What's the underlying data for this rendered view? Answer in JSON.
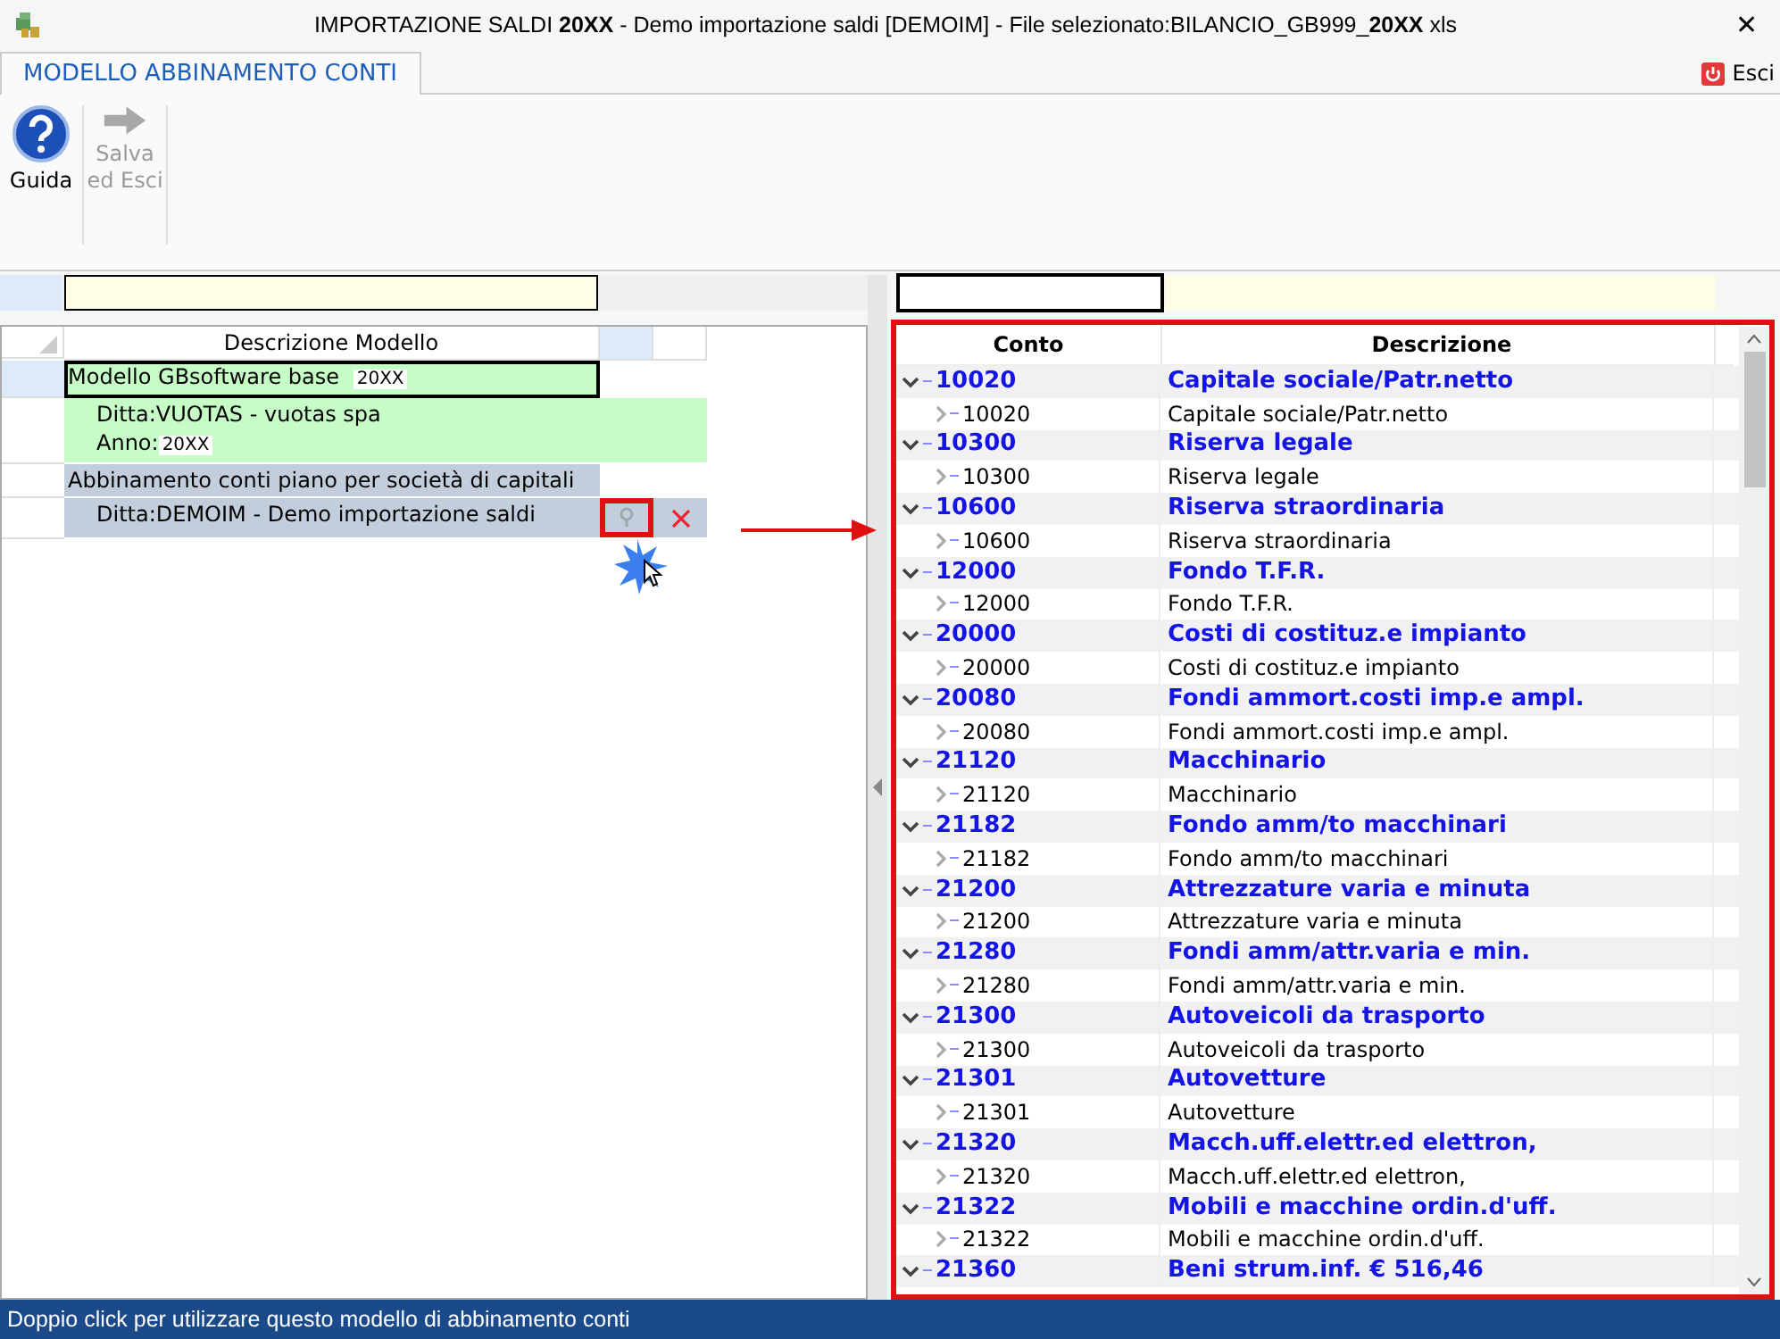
{
  "window": {
    "title": "IMPORTAZIONE SALDI **20XX** - Demo importazione saldi [DEMOIM] - File selezionato:BILANCIO_GB999_**20XX** xls",
    "close": "✕"
  },
  "tabs": [
    {
      "label": "MODELLO ABBINAMENTO CONTI",
      "selected": true
    }
  ],
  "exit_button": "Esci",
  "toolbar": [
    {
      "label": "Guida",
      "disabled": false,
      "kind": "help"
    },
    {
      "label": "Salva\ned Esci",
      "disabled": true,
      "kind": "save"
    }
  ],
  "models": {
    "column": "Descrizione Modello",
    "rows": [
      {
        "kind": "model",
        "label": "Modello GBsoftware base",
        "year": "20XX",
        "color": "#c6fcc6",
        "selected": true
      },
      {
        "kind": "company",
        "label": "Ditta:VUOTAS - vuotas spa",
        "year_label": "Anno:",
        "year": "20XX",
        "color": "#c6fcc6",
        "selected": false
      },
      {
        "kind": "model",
        "label": "Abbinamento conti piano per società di capitali",
        "color": "#c3cedc",
        "selected": false
      },
      {
        "kind": "company",
        "label": "Ditta:DEMOIM - Demo importazione saldi",
        "color": "#c3cedc",
        "selected": false,
        "actions": true
      }
    ]
  },
  "accounts": {
    "columns": [
      "Conto",
      "Descrizione"
    ],
    "rows": [
      {
        "code": "10020",
        "description": "Capitale sociale/Patr.netto",
        "expanded": true,
        "children": [
          {
            "code": "10020",
            "description": "Capitale sociale/Patr.netto"
          }
        ]
      },
      {
        "code": "10300",
        "description": "Riserva legale",
        "expanded": true,
        "children": [
          {
            "code": "10300",
            "description": "Riserva legale"
          }
        ]
      },
      {
        "code": "10600",
        "description": "Riserva straordinaria",
        "expanded": true,
        "children": [
          {
            "code": "10600",
            "description": "Riserva straordinaria"
          }
        ]
      },
      {
        "code": "12000",
        "description": "Fondo T.F.R.",
        "expanded": true,
        "children": [
          {
            "code": "12000",
            "description": "Fondo T.F.R."
          }
        ]
      },
      {
        "code": "20000",
        "description": "Costi di costituz.e impianto",
        "expanded": true,
        "children": [
          {
            "code": "20000",
            "description": "Costi di costituz.e impianto"
          }
        ]
      },
      {
        "code": "20080",
        "description": "Fondi ammort.costi imp.e ampl.",
        "expanded": true,
        "children": [
          {
            "code": "20080",
            "description": "Fondi ammort.costi imp.e ampl."
          }
        ]
      },
      {
        "code": "21120",
        "description": "Macchinario",
        "expanded": true,
        "children": [
          {
            "code": "21120",
            "description": "Macchinario"
          }
        ]
      },
      {
        "code": "21182",
        "description": "Fondo amm/to macchinari",
        "expanded": true,
        "children": [
          {
            "code": "21182",
            "description": "Fondo amm/to macchinari"
          }
        ]
      },
      {
        "code": "21200",
        "description": "Attrezzature varia e minuta",
        "expanded": true,
        "children": [
          {
            "code": "21200",
            "description": "Attrezzature varia e minuta"
          }
        ]
      },
      {
        "code": "21280",
        "description": "Fondi amm/attr.varia e min.",
        "expanded": true,
        "children": [
          {
            "code": "21280",
            "description": "Fondi amm/attr.varia e min."
          }
        ]
      },
      {
        "code": "21300",
        "description": "Autoveicoli da trasporto",
        "expanded": true,
        "children": [
          {
            "code": "21300",
            "description": "Autoveicoli da trasporto"
          }
        ]
      },
      {
        "code": "21301",
        "description": "Autovetture",
        "expanded": true,
        "children": [
          {
            "code": "21301",
            "description": "Autovetture"
          }
        ]
      },
      {
        "code": "21320",
        "description": "Macch.uff.elettr.ed elettron,",
        "expanded": true,
        "children": [
          {
            "code": "21320",
            "description": "Macch.uff.elettr.ed elettron,"
          }
        ]
      },
      {
        "code": "21322",
        "description": "Mobili e macchine ordin.d'uff.",
        "expanded": true,
        "children": [
          {
            "code": "21322",
            "description": "Mobili e macchine ordin.d'uff."
          }
        ]
      },
      {
        "code": "21360",
        "description": "Beni strum.inf. € 516,46",
        "expanded": true
      }
    ]
  },
  "status_bar": "Doppio click per utilizzare questo modello di abbinamento conti"
}
